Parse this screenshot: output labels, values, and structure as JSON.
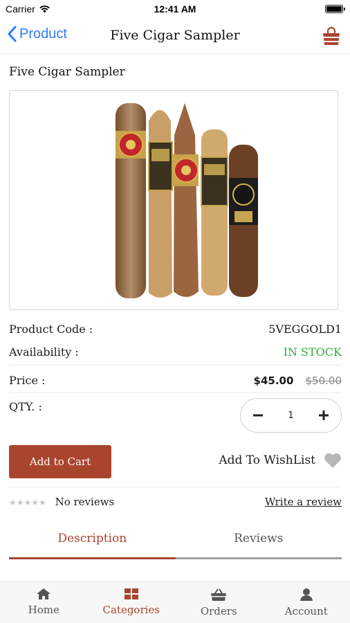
{
  "status": {
    "carrier": "Carrier",
    "time": "12:41 AM"
  },
  "nav": {
    "back_label": "Product",
    "title": "Five Cigar Sampler",
    "cart_icon": "shopping-bag-icon"
  },
  "product": {
    "name": "Five Cigar Sampler",
    "code_label": "Product Code :",
    "code_value": "5VEGGOLD1",
    "availability_label": "Availability :",
    "availability_value": "IN STOCK",
    "price_label": "Price :",
    "price_current": "$45.00",
    "price_old": "$50.00",
    "qty_label": "QTY. :",
    "qty_value": "1"
  },
  "actions": {
    "add_to_cart": "Add to Cart",
    "add_to_wishlist": "Add To WishList"
  },
  "reviews": {
    "summary": "No reviews",
    "write_review": "Write a review",
    "rating": 0,
    "stars": "★★★★★"
  },
  "tabs": [
    {
      "label": "Description",
      "active": true
    },
    {
      "label": "Reviews",
      "active": false
    }
  ],
  "tab_bar": [
    {
      "label": "Home",
      "icon": "home-icon",
      "active": false
    },
    {
      "label": "Categories",
      "icon": "grid-icon",
      "active": true
    },
    {
      "label": "Orders",
      "icon": "basket-icon",
      "active": false
    },
    {
      "label": "Account",
      "icon": "user-icon",
      "active": false
    }
  ],
  "colors": {
    "accent": "#a9452e",
    "ios_blue": "#2f7cf6",
    "in_stock": "#2cab34"
  }
}
